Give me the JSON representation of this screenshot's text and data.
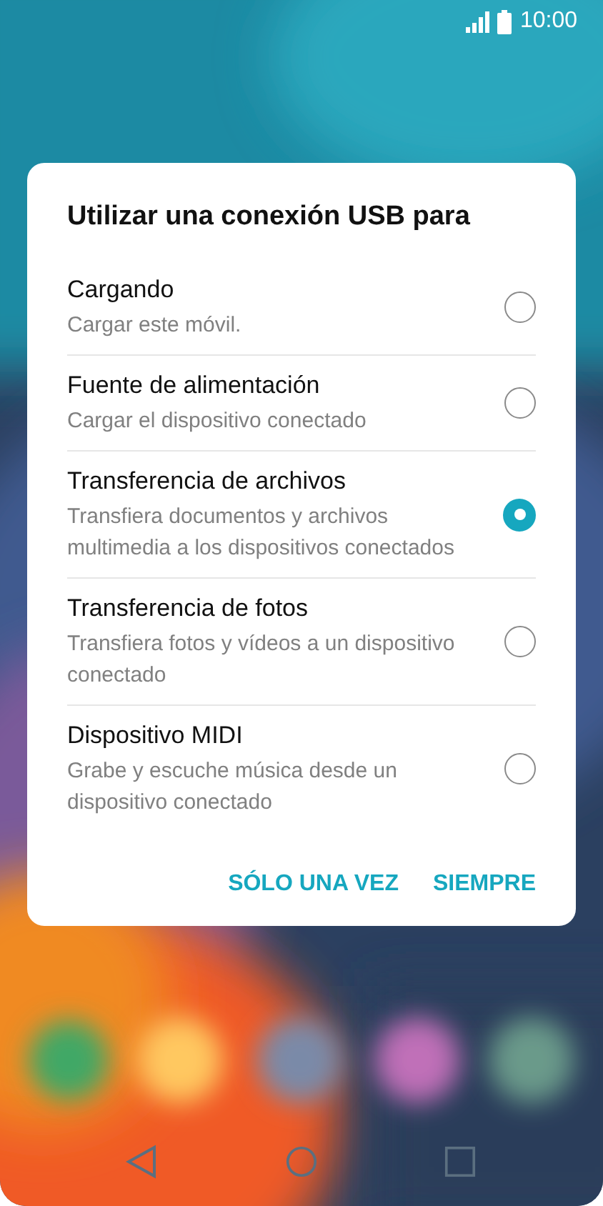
{
  "status_bar": {
    "time": "10:00"
  },
  "dialog": {
    "title": "Utilizar una conexión USB para",
    "options": [
      {
        "title": "Cargando",
        "subtitle": "Cargar este móvil.",
        "selected": false
      },
      {
        "title": "Fuente de alimentación",
        "subtitle": "Cargar el dispositivo conectado",
        "selected": false
      },
      {
        "title": "Transferencia de archivos",
        "subtitle": "Transfiera documentos y archivos multimedia a los dispositivos conectados",
        "selected": true
      },
      {
        "title": "Transferencia de fotos",
        "subtitle": "Transfiera fotos y vídeos a un dispositivo conectado",
        "selected": false
      },
      {
        "title": "Dispositivo MIDI",
        "subtitle": "Grabe y escuche música desde un dispositivo conectado",
        "selected": false
      }
    ],
    "buttons": [
      "SÓLO UNA VEZ",
      "SIEMPRE"
    ]
  }
}
